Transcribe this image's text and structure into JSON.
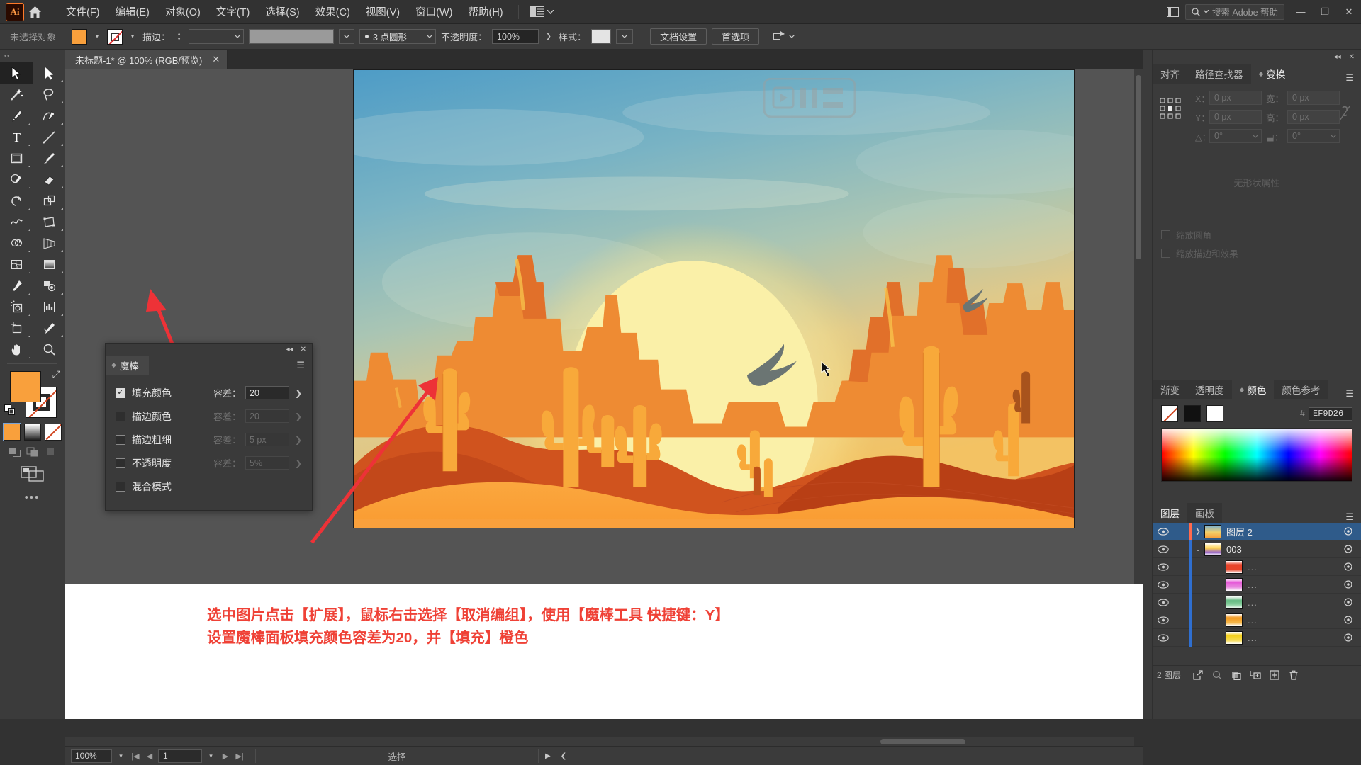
{
  "app": {
    "name": "Adobe Illustrator",
    "logo_text": "Ai"
  },
  "menubar": {
    "items": [
      {
        "label": "文件(F)",
        "name": "menu-file"
      },
      {
        "label": "编辑(E)",
        "name": "menu-edit"
      },
      {
        "label": "对象(O)",
        "name": "menu-object"
      },
      {
        "label": "文字(T)",
        "name": "menu-type"
      },
      {
        "label": "选择(S)",
        "name": "menu-select"
      },
      {
        "label": "效果(C)",
        "name": "menu-effect"
      },
      {
        "label": "视图(V)",
        "name": "menu-view"
      },
      {
        "label": "窗口(W)",
        "name": "menu-window"
      },
      {
        "label": "帮助(H)",
        "name": "menu-help"
      }
    ],
    "search_placeholder": "搜索 Adobe 帮助",
    "minimize": "—",
    "maximize": "❐",
    "close": "✕"
  },
  "controlbar": {
    "selection_status": "未选择对象",
    "fill_color": "#F9A03C",
    "stroke_label": "描边：",
    "stroke_weight": "",
    "stroke_profile": "",
    "brush_label": "",
    "brush_preset": "3 点圆形",
    "opacity_label": "不透明度：",
    "opacity_value": "100%",
    "style_label": "样式：",
    "doc_setup_button": "文档设置",
    "preferences_button": "首选项"
  },
  "document_tab": {
    "title": "未标题-1* @ 100% (RGB/预览)",
    "close": "✕"
  },
  "toolbar": {
    "tools": [
      {
        "name": "selection-tool",
        "glyph": "selection",
        "active": true
      },
      {
        "name": "direct-selection-tool",
        "glyph": "direct-selection",
        "active": false
      },
      {
        "name": "magic-wand-tool",
        "glyph": "magic-wand",
        "active": false
      },
      {
        "name": "lasso-tool",
        "glyph": "lasso",
        "active": false
      },
      {
        "name": "pen-tool",
        "glyph": "pen",
        "active": false
      },
      {
        "name": "curvature-tool",
        "glyph": "curvature",
        "active": false
      },
      {
        "name": "type-tool",
        "glyph": "type",
        "active": false
      },
      {
        "name": "line-segment-tool",
        "glyph": "line",
        "active": false
      },
      {
        "name": "rectangle-tool",
        "glyph": "rectangle",
        "active": false
      },
      {
        "name": "paintbrush-tool",
        "glyph": "paintbrush",
        "active": false
      },
      {
        "name": "shaper-tool",
        "glyph": "shaper",
        "active": false
      },
      {
        "name": "eraser-tool",
        "glyph": "eraser",
        "active": false
      },
      {
        "name": "rotate-tool",
        "glyph": "rotate",
        "active": false
      },
      {
        "name": "scale-tool",
        "glyph": "scale",
        "active": false
      },
      {
        "name": "width-tool",
        "glyph": "width",
        "active": false
      },
      {
        "name": "free-transform-tool",
        "glyph": "free-transform",
        "active": false
      },
      {
        "name": "shape-builder-tool",
        "glyph": "shape-builder",
        "active": false
      },
      {
        "name": "perspective-grid-tool",
        "glyph": "perspective",
        "active": false
      },
      {
        "name": "mesh-tool",
        "glyph": "mesh",
        "active": false
      },
      {
        "name": "gradient-tool",
        "glyph": "gradient",
        "active": false
      },
      {
        "name": "eyedropper-tool",
        "glyph": "eyedropper",
        "active": false
      },
      {
        "name": "blend-tool",
        "glyph": "blend",
        "active": false
      },
      {
        "name": "symbol-sprayer-tool",
        "glyph": "symbol-sprayer",
        "active": false
      },
      {
        "name": "column-graph-tool",
        "glyph": "column-graph",
        "active": false
      },
      {
        "name": "artboard-tool",
        "glyph": "artboard",
        "active": false
      },
      {
        "name": "slice-tool",
        "glyph": "slice",
        "active": false
      },
      {
        "name": "hand-tool",
        "glyph": "hand",
        "active": false
      },
      {
        "name": "zoom-tool",
        "glyph": "zoom",
        "active": false
      }
    ],
    "fill_color": "#F9A03C",
    "stroke_color": "none",
    "modes": [
      "normal-fill",
      "gradient-fill",
      "none-fill"
    ],
    "drawing_modes": [
      "draw-normal",
      "draw-behind",
      "draw-inside"
    ],
    "screen_mode": "change-screen-mode",
    "more_tools": "•••"
  },
  "magic_wand_panel": {
    "tab_label": "魔棒",
    "rows": [
      {
        "name": "fill-color",
        "label": "填充颜色",
        "checked": true,
        "tolerance_label": "容差：",
        "tolerance_value": "20",
        "enabled": true
      },
      {
        "name": "stroke-color",
        "label": "描边颜色",
        "checked": false,
        "tolerance_label": "容差：",
        "tolerance_value": "20",
        "enabled": false
      },
      {
        "name": "stroke-weight",
        "label": "描边粗细",
        "checked": false,
        "tolerance_label": "容差：",
        "tolerance_value": "5 px",
        "enabled": false
      },
      {
        "name": "opacity",
        "label": "不透明度",
        "checked": false,
        "tolerance_label": "容差：",
        "tolerance_value": "5%",
        "enabled": false
      },
      {
        "name": "blending-mode",
        "label": "混合模式",
        "checked": false,
        "tolerance_label": "",
        "tolerance_value": "",
        "enabled": false
      }
    ]
  },
  "transform_panel": {
    "tabs": [
      {
        "label": "对齐",
        "active": false,
        "name": "tab-align"
      },
      {
        "label": "路径查找器",
        "active": false,
        "name": "tab-pathfinder"
      },
      {
        "label": "变换",
        "active": true,
        "name": "tab-transform"
      }
    ],
    "fields": {
      "x_label": "X：",
      "x_value": "0 px",
      "y_label": "Y：",
      "y_value": "0 px",
      "w_label": "宽：",
      "w_value": "0 px",
      "h_label": "高：",
      "h_value": "0 px",
      "angle_label": "△：",
      "angle_value": "0°",
      "shear_label": "⬓：",
      "shear_value": "0°"
    },
    "no_props_text": "无形状属性",
    "checkboxes": [
      {
        "label": "缩放圆角",
        "checked": false,
        "name": "scale-corners-checkbox"
      },
      {
        "label": "缩放描边和效果",
        "checked": false,
        "name": "scale-strokes-checkbox"
      }
    ]
  },
  "color_panel": {
    "tabs": [
      {
        "label": "渐变",
        "active": false,
        "name": "tab-gradient"
      },
      {
        "label": "透明度",
        "active": false,
        "name": "tab-transparency"
      },
      {
        "label": "颜色",
        "active": true,
        "name": "tab-color"
      },
      {
        "label": "颜色参考",
        "active": false,
        "name": "tab-color-guide"
      }
    ],
    "hash_label": "#",
    "hex_value": "EF9D26",
    "swatches": [
      "none",
      "#000000",
      "#FFFFFF"
    ]
  },
  "layers_panel": {
    "tabs": [
      {
        "label": "图层",
        "active": true,
        "name": "tab-layers"
      },
      {
        "label": "画板",
        "active": false,
        "name": "tab-artboards"
      }
    ],
    "rows": [
      {
        "name": "图层 2",
        "selected": true,
        "indent": 0,
        "color": "#ff6a4d",
        "expandable": true,
        "expanded": false,
        "thumb": "artwork",
        "visible": true
      },
      {
        "name": "003",
        "selected": false,
        "indent": 1,
        "color": "#2f6fd0",
        "expandable": true,
        "expanded": true,
        "thumb": "group",
        "visible": true
      },
      {
        "name": "...",
        "selected": false,
        "indent": 2,
        "color": "#2f6fd0",
        "expandable": false,
        "expanded": false,
        "thumb": "red",
        "visible": true
      },
      {
        "name": "...",
        "selected": false,
        "indent": 2,
        "color": "#2f6fd0",
        "expandable": false,
        "expanded": false,
        "thumb": "magenta",
        "visible": true
      },
      {
        "name": "...",
        "selected": false,
        "indent": 2,
        "color": "#2f6fd0",
        "expandable": false,
        "expanded": false,
        "thumb": "green",
        "visible": true
      },
      {
        "name": "...",
        "selected": false,
        "indent": 2,
        "color": "#2f6fd0",
        "expandable": false,
        "expanded": false,
        "thumb": "orange",
        "visible": true
      },
      {
        "name": "...",
        "selected": false,
        "indent": 2,
        "color": "#2f6fd0",
        "expandable": false,
        "expanded": false,
        "thumb": "yellow",
        "visible": true
      }
    ],
    "footer_count": "2 图层",
    "footer_icons": [
      "locate-object",
      "make-clipping-mask",
      "create-sublayer",
      "create-new-layer",
      "delete-selection"
    ]
  },
  "statusbar": {
    "zoom_value": "100%",
    "page_value": "1",
    "status_text": "选择",
    "first_label": "|◀",
    "prev_label": "◀",
    "next_label": "▶",
    "last_label": "▶|"
  },
  "annotation": {
    "line1": "选中图片点击【扩展】，鼠标右击选择【取消编组】，使用【魔棒工具 快捷键：Y】",
    "line2": "设置魔棒面板填充颜色容差为20，并【填充】橙色",
    "color": "#EF4136"
  },
  "artwork": {
    "title": "desert-sunset-illustration",
    "sky_top": "#5BA3C9",
    "sky_mid": "#8FC0C0",
    "sun_color": "#FAF0A8",
    "sand_color": "#F9A03C",
    "mesa_color": "#E8762B",
    "dune_shadow": "#C8441B"
  }
}
